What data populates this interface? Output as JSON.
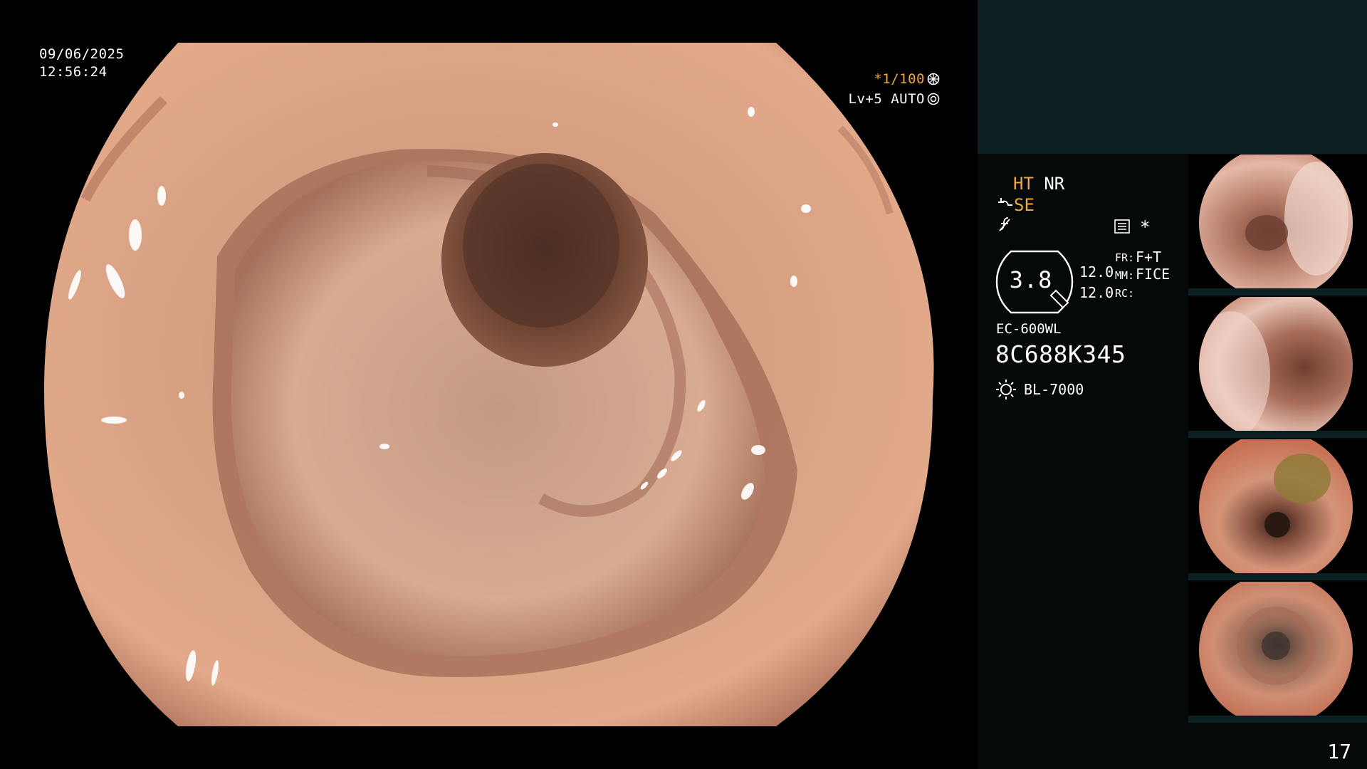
{
  "main_view": {
    "date": "09/06/2025",
    "time": "12:56:24",
    "shutter": "*1/100",
    "level": "Lv+5 AUTO"
  },
  "settings": {
    "ht": "HT",
    "nr": "NR",
    "se": "SE",
    "zoom": "3.8",
    "value_a": "12.0",
    "value_b": "12.0",
    "fr_label": "FR:",
    "fr_value": "F+T",
    "mm_label": "MM:",
    "mm_value": "FICE",
    "rc_label": "RC:",
    "scope_model": "EC-600WL",
    "scope_serial": "8C688K345",
    "light_source": "BL-7000"
  },
  "thumbnails": [
    {
      "name": "thumbnail-1"
    },
    {
      "name": "thumbnail-2"
    },
    {
      "name": "thumbnail-3"
    },
    {
      "name": "thumbnail-4"
    }
  ],
  "page_number": "17",
  "colors": {
    "accent_orange": "#f0a63a",
    "panel_dark": "#06090a",
    "panel_top": "#0b1e21",
    "mucosa": "#d79b80"
  }
}
